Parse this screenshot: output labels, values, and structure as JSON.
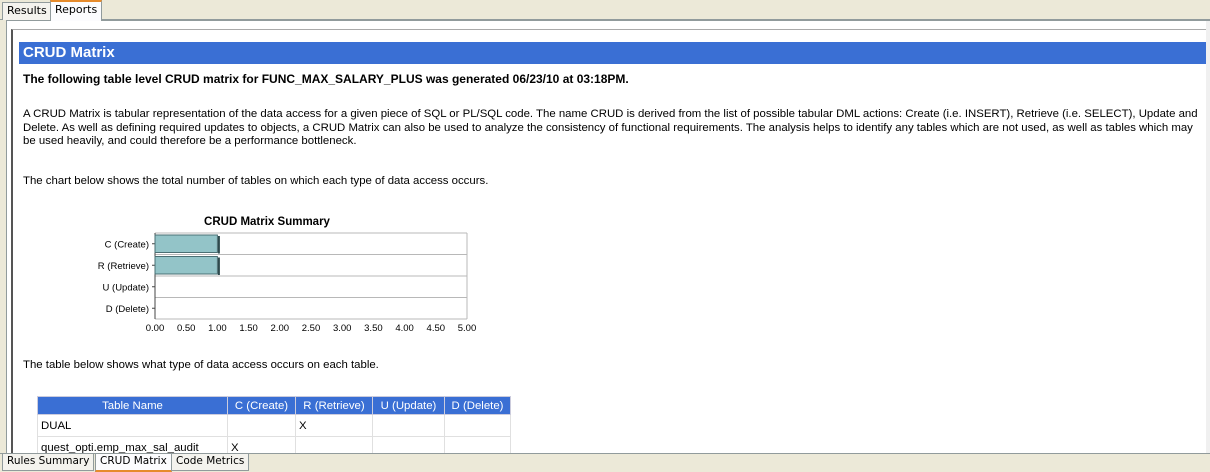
{
  "top_tabs": [
    {
      "label": "Results",
      "active": false
    },
    {
      "label": "Reports",
      "active": true
    }
  ],
  "report": {
    "header": "CRUD Matrix",
    "subtitle": "The following table level CRUD matrix for FUNC_MAX_SALARY_PLUS was generated 06/23/10 at 03:18PM.",
    "description": "A CRUD Matrix is tabular representation of the data access for a given piece of SQL or PL/SQL code. The name CRUD is derived from the list of possible tabular DML actions: Create (i.e. INSERT), Retrieve (i.e. SELECT), Update and Delete. As well as defining required updates to objects, a CRUD Matrix can also be used to analyze the consistency of functional requirements. The analysis helps to identify any tables which are not used, as well as tables which may be used heavily, and could therefore be a performance bottleneck.",
    "chart_note": "The chart below shows the total number of tables on which each type of data access occurs.",
    "table_note": "The table below shows what type of data access occurs on each table."
  },
  "chart_data": {
    "type": "bar",
    "orientation": "horizontal",
    "title": "CRUD Matrix Summary",
    "categories": [
      "C (Create)",
      "R (Retrieve)",
      "U (Update)",
      "D (Delete)"
    ],
    "values": [
      1,
      1,
      0,
      0
    ],
    "xlim": [
      0,
      5
    ],
    "xticks": [
      "0.00",
      "0.50",
      "1.00",
      "1.50",
      "2.00",
      "2.50",
      "3.00",
      "3.50",
      "4.00",
      "4.50",
      "5.00"
    ],
    "bar_color": "#93c4c8",
    "grid": true
  },
  "crud_table": {
    "headers": [
      "Table Name",
      "C (Create)",
      "R (Retrieve)",
      "U (Update)",
      "D (Delete)"
    ],
    "rows": [
      [
        "DUAL",
        "",
        "X",
        "",
        ""
      ],
      [
        "quest_opti.emp_max_sal_audit",
        "X",
        "",
        "",
        ""
      ]
    ]
  },
  "bottom_tabs": [
    {
      "label": "Rules Summary",
      "active": false
    },
    {
      "label": "CRUD Matrix",
      "active": true
    },
    {
      "label": "Code Metrics",
      "active": false
    }
  ],
  "colors": {
    "header_bg": "#3a6fd4",
    "active_tab_accent": "#e68b2c"
  }
}
